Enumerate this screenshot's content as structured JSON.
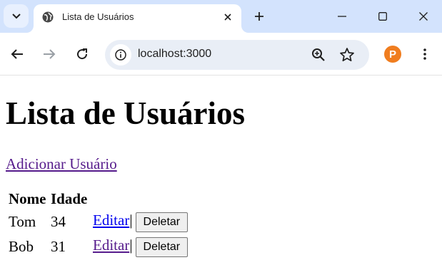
{
  "browser": {
    "tab_title": "Lista de Usuários",
    "url": "localhost:3000",
    "extension_letter": "P"
  },
  "page": {
    "heading": "Lista de Usuários",
    "add_link": "Adicionar Usuário",
    "table": {
      "headers": [
        "Nome",
        "Idade"
      ],
      "rows": [
        {
          "name": "Tom",
          "age": "34",
          "edit": "Editar",
          "separator": "|",
          "delete": "Deletar"
        },
        {
          "name": "Bob",
          "age": "31",
          "edit": "Editar",
          "separator": "|",
          "delete": "Deletar"
        }
      ]
    }
  },
  "colors": {
    "tabstrip": "#d3e3fd",
    "omnibox": "#e9eef6",
    "link_visited": "#551a8b",
    "link_unvisited": "#0000ee",
    "extension": "#f07d1f"
  }
}
